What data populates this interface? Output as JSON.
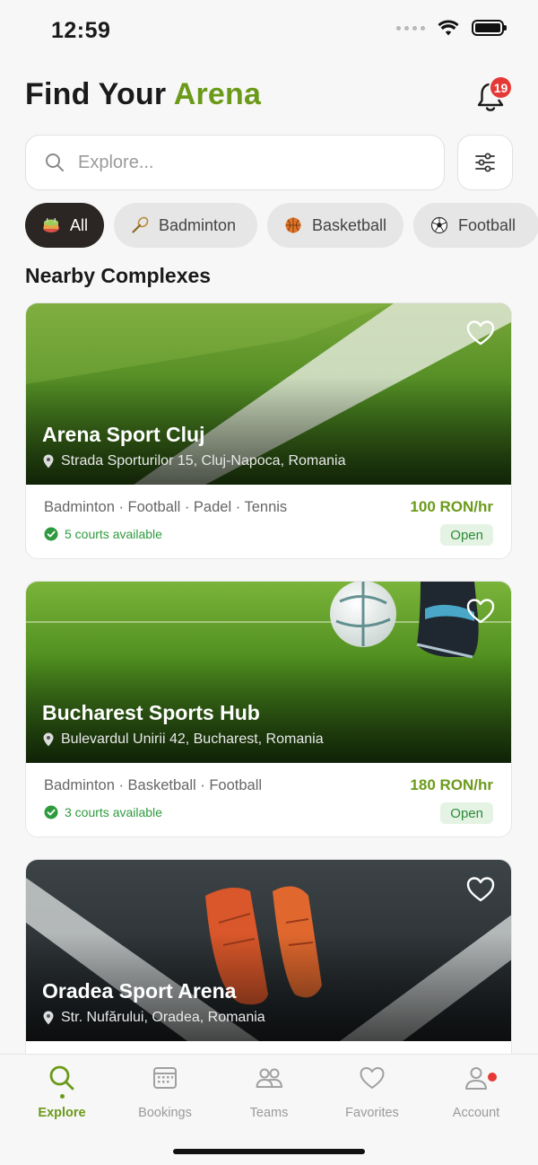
{
  "status_bar": {
    "time": "12:59"
  },
  "header": {
    "title_part1": "Find Your ",
    "title_accent": "Arena",
    "notification_count": "19"
  },
  "search": {
    "placeholder": "Explore..."
  },
  "chips": [
    {
      "label": "All",
      "icon": "stadium-icon",
      "active": true
    },
    {
      "label": "Badminton",
      "icon": "badminton-racket-icon",
      "active": false
    },
    {
      "label": "Basketball",
      "icon": "basketball-icon",
      "active": false
    },
    {
      "label": "Football",
      "icon": "football-icon",
      "active": false
    }
  ],
  "section_title": "Nearby Complexes",
  "complexes": [
    {
      "name": "Arena Sport Cluj",
      "address": "Strada Sporturilor 15, Cluj-Napoca, Romania",
      "sports": "Badminton · Football · Padel · Tennis",
      "price": "100 RON/hr",
      "courts": "5 courts available",
      "status": "Open"
    },
    {
      "name": "Bucharest Sports Hub",
      "address": "Bulevardul Unirii 42, Bucharest, Romania",
      "sports": "Badminton · Basketball · Football",
      "price": "180 RON/hr",
      "courts": "3 courts available",
      "status": "Open"
    },
    {
      "name": "Oradea Sport Arena",
      "address": "Str. Nufărului, Oradea, Romania"
    }
  ],
  "bottom_nav": [
    {
      "label": "Explore",
      "icon": "search-icon",
      "active": true
    },
    {
      "label": "Bookings",
      "icon": "calendar-icon",
      "active": false
    },
    {
      "label": "Teams",
      "icon": "people-icon",
      "active": false
    },
    {
      "label": "Favorites",
      "icon": "heart-icon",
      "active": false
    },
    {
      "label": "Account",
      "icon": "user-icon",
      "active": false
    }
  ],
  "colors": {
    "accent": "#6b9a1a",
    "badge": "#e53935",
    "active_chip": "#2b2623",
    "open_bg": "#e4f3e3",
    "courts_text": "#2e9a3d"
  }
}
